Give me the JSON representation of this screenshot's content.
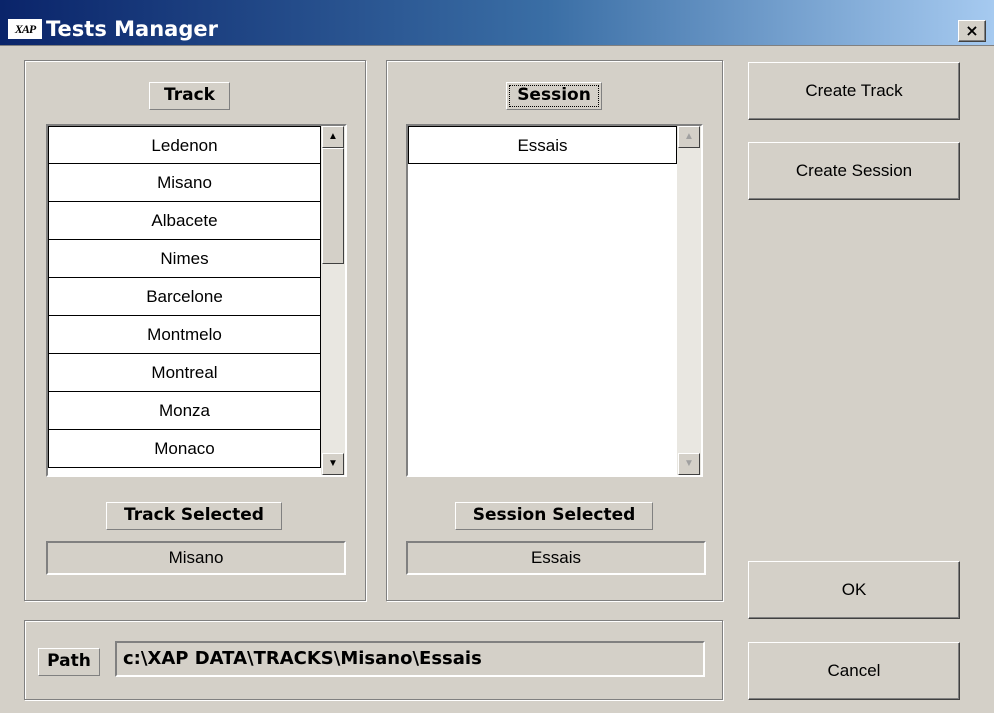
{
  "window": {
    "title": "Tests Manager",
    "logo": "XAP",
    "close": "×"
  },
  "track": {
    "header": "Track",
    "items": [
      "Ledenon",
      "Misano",
      "Albacete",
      "Nimes",
      "Barcelone",
      "Montmelo",
      "Montreal",
      "Monza",
      "Monaco"
    ],
    "selected_label": "Track Selected",
    "selected_value": "Misano"
  },
  "session": {
    "header": "Session",
    "items": [
      "Essais"
    ],
    "selected_label": "Session Selected",
    "selected_value": "Essais"
  },
  "path": {
    "label": "Path",
    "value": "c:\\XAP DATA\\TRACKS\\Misano\\Essais"
  },
  "buttons": {
    "create_track": "Create Track",
    "create_session": "Create Session",
    "ok": "OK",
    "cancel": "Cancel"
  },
  "icons": {
    "scroll_up": "▲",
    "scroll_down": "▼"
  }
}
